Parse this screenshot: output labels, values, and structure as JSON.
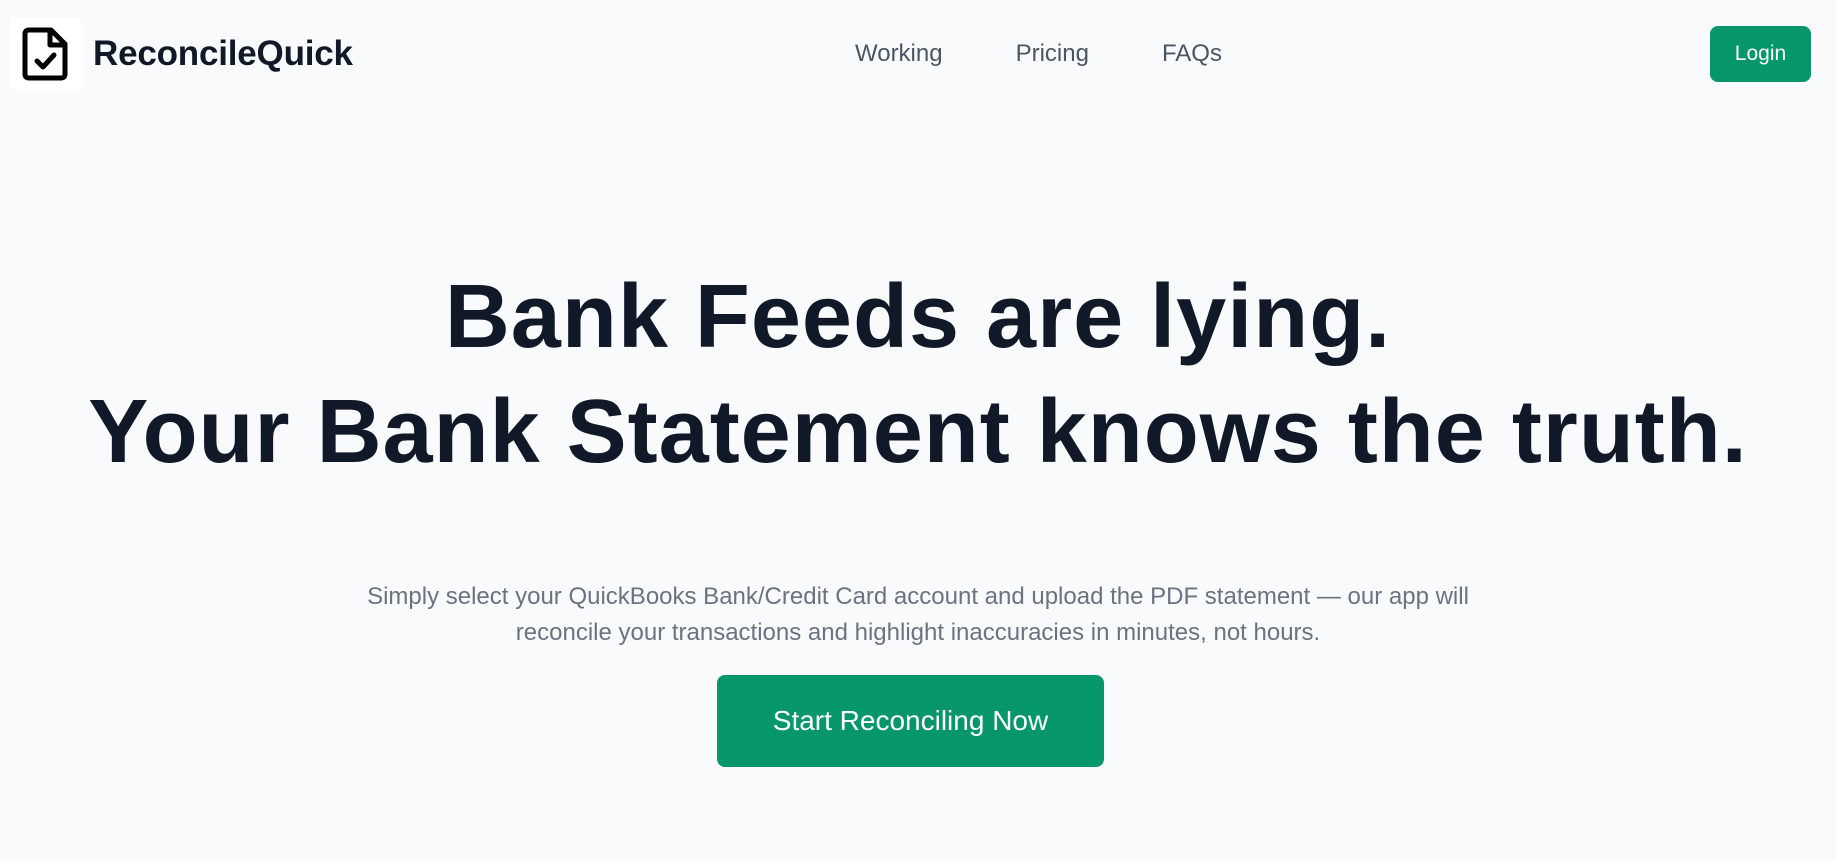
{
  "brand": {
    "name": "ReconcileQuick",
    "logo_icon": "file-check-icon"
  },
  "nav": {
    "items": [
      {
        "label": "Working"
      },
      {
        "label": "Pricing"
      },
      {
        "label": "FAQs"
      }
    ]
  },
  "header": {
    "login_label": "Login"
  },
  "hero": {
    "headline_line1": "Bank Feeds are lying.",
    "headline_line2": "Your Bank Statement knows the truth.",
    "subtext_line1": "Simply select your QuickBooks Bank/Credit Card account and upload the PDF statement — our app will",
    "subtext_line2": "reconcile your transactions and highlight inaccuracies in minutes, not hours.",
    "cta_label": "Start Reconciling Now"
  },
  "colors": {
    "accent": "#059669",
    "background": "#f8fafc",
    "heading": "#111827",
    "muted": "#6b7280",
    "nav": "#4b5563"
  }
}
